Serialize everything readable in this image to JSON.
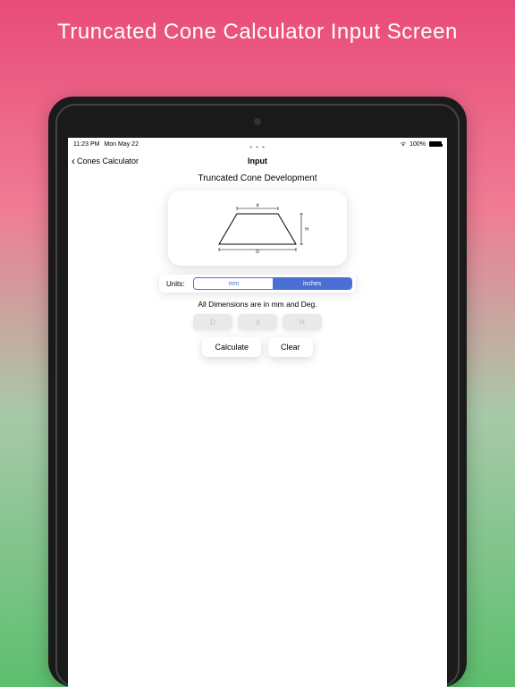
{
  "promo": {
    "title": "Truncated Cone Calculator Input Screen"
  },
  "status": {
    "time": "11:23 PM",
    "date": "Mon May 22",
    "battery": "100%"
  },
  "nav": {
    "back_label": "Cones Calculator",
    "title": "Input",
    "dots": "• • •"
  },
  "page": {
    "title": "Truncated Cone Development",
    "units_label": "Units:",
    "unit_mm": "mm",
    "unit_inches": "inches",
    "note": "All Dimensions are in mm and Deg.",
    "input_D": "D",
    "input_d": "d",
    "input_H": "H",
    "calculate": "Calculate",
    "clear": "Clear"
  },
  "diagram": {
    "label_top": "d",
    "label_bottom": "D",
    "label_height": "H"
  }
}
